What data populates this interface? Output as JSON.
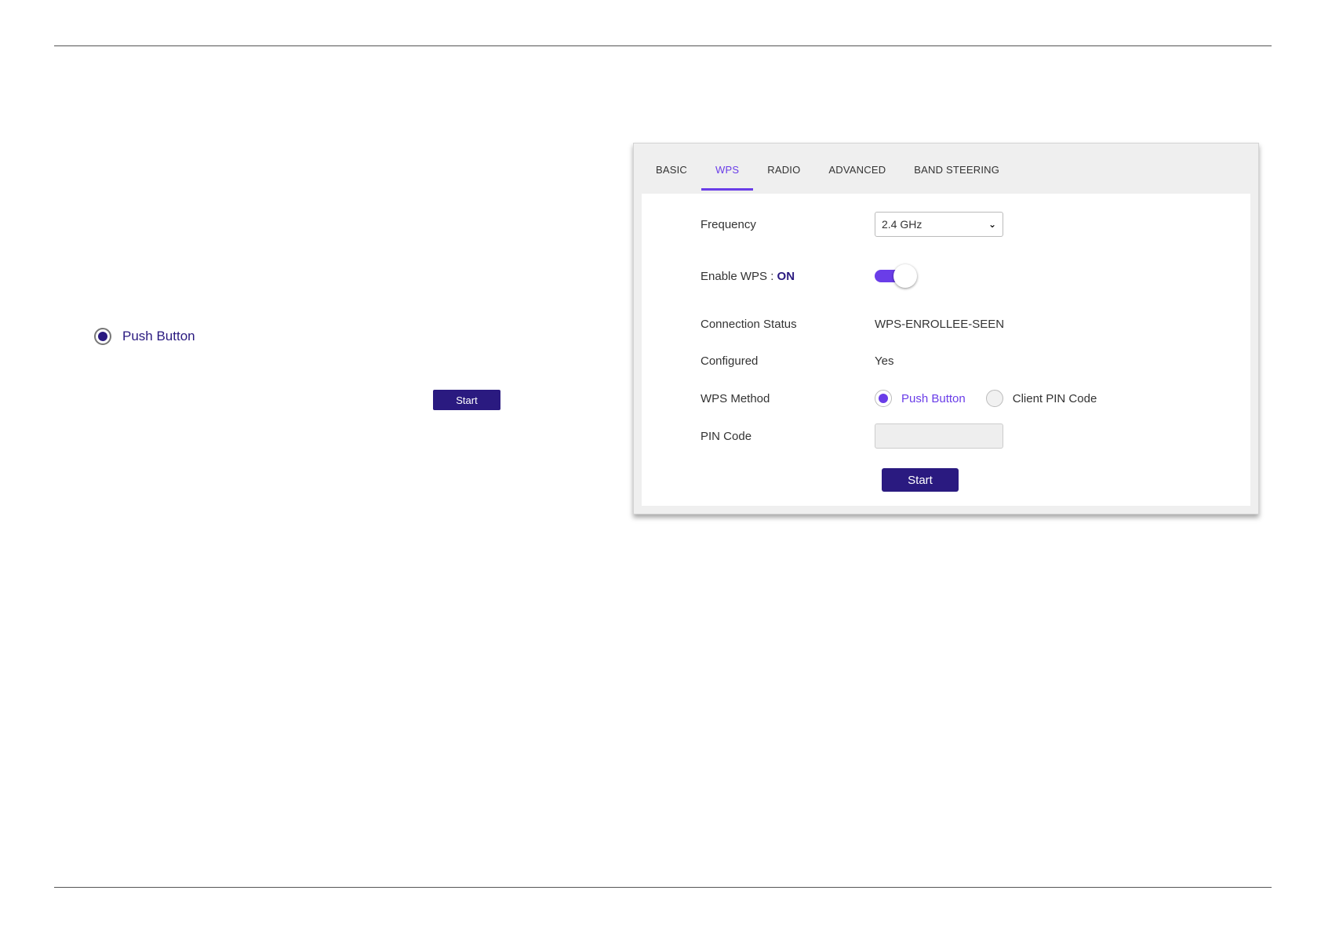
{
  "left_callout": {
    "radio_label": "Push Button",
    "start_label": "Start"
  },
  "tabs": [
    {
      "label": "BASIC"
    },
    {
      "label": "WPS"
    },
    {
      "label": "RADIO"
    },
    {
      "label": "ADVANCED"
    },
    {
      "label": "BAND STEERING"
    }
  ],
  "active_tab": "WPS",
  "form": {
    "frequency": {
      "label": "Frequency",
      "value": "2.4 GHz"
    },
    "enable_wps": {
      "label": "Enable WPS : ",
      "state_text": "ON",
      "on": true
    },
    "connection_status": {
      "label": "Connection Status",
      "value": "WPS-ENROLLEE-SEEN"
    },
    "configured": {
      "label": "Configured",
      "value": "Yes"
    },
    "wps_method": {
      "label": "WPS Method",
      "options": [
        {
          "label": "Push Button",
          "selected": true
        },
        {
          "label": "Client PIN Code",
          "selected": false
        }
      ]
    },
    "pin_code": {
      "label": "PIN Code",
      "value": "",
      "placeholder": ""
    },
    "start_label": "Start"
  },
  "colors": {
    "accent": "#6a3de8",
    "primary_button": "#2a1a80"
  }
}
